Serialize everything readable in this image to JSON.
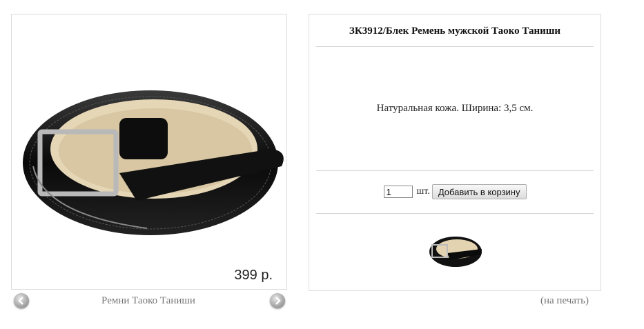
{
  "product": {
    "title": "ЗК3912/Блек Ремень мужской Таоко Таниши",
    "description": "Натуральная кожа. Ширина: 3,5 см.",
    "price": "399 р.",
    "image_icon": "belt-image",
    "thumbnail_icon": "belt-thumbnail"
  },
  "gallery": {
    "caption": "Ремни Таоко Таниши",
    "prev_icon": "arrow-left-icon",
    "next_icon": "arrow-right-icon"
  },
  "cart": {
    "quantity": "1",
    "unit_label": "шт.",
    "add_button_label": "Добавить в корзину"
  },
  "print_link": "(на печать)"
}
